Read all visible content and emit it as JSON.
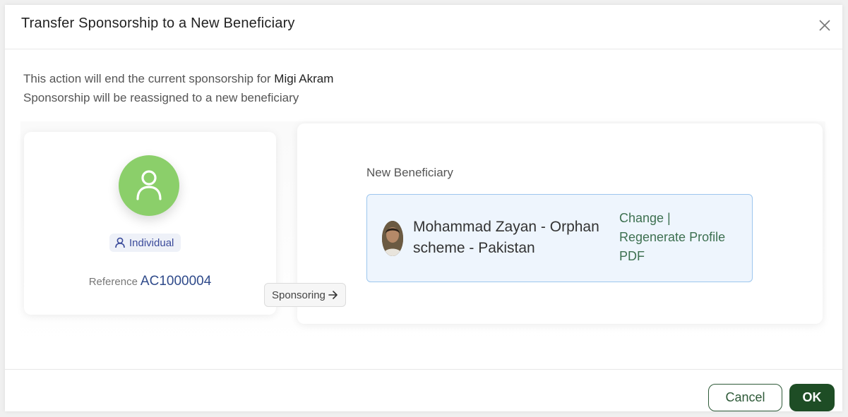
{
  "dialog": {
    "title": "Transfer Sponsorship to a New Beneficiary",
    "message_prefix": "This action will end the current sponsorship for ",
    "message_name": "Migi Akram",
    "message_line2": "Sponsorship will be reassigned to a new beneficiary"
  },
  "current": {
    "type_badge": "Individual",
    "reference_label": "Reference",
    "reference_value": "AC1000004"
  },
  "sponsoring_label": "Sponsoring",
  "new_beneficiary": {
    "label": "New Beneficiary",
    "name": "Mohammad Zayan - Orphan scheme - Pakistan",
    "change_label": "Change |",
    "regenerate_label": "Regenerate Profile PDF"
  },
  "footer": {
    "cancel_label": "Cancel",
    "ok_label": "OK"
  },
  "colors": {
    "avatar_bg": "#8bcf6a",
    "link": "#3d7050",
    "ok_bg": "#1e4d25"
  },
  "icons": {
    "close": "close-icon",
    "avatar": "user-icon",
    "badge": "user-outline-icon",
    "arrow": "arrow-right-icon"
  }
}
